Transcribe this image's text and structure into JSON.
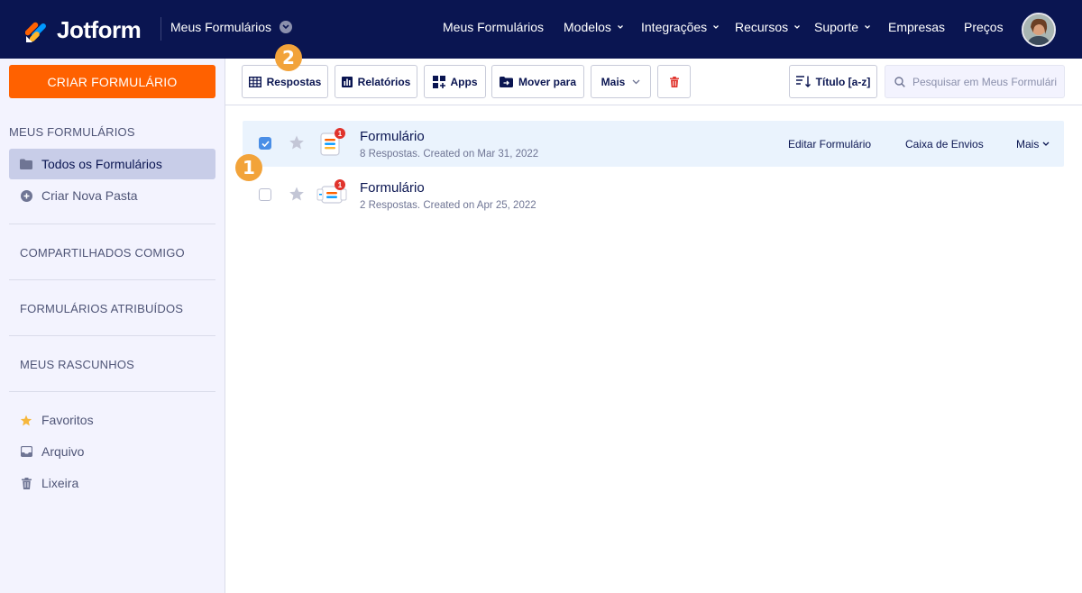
{
  "header": {
    "brand": "Jotform",
    "myforms_dropdown": "Meus Formulários",
    "nav": [
      {
        "label": "Meus Formulários",
        "caret": false
      },
      {
        "label": "Modelos",
        "caret": true
      },
      {
        "label": "Integrações",
        "caret": true
      },
      {
        "label": "Recursos",
        "caret": true
      },
      {
        "label": "Suporte",
        "caret": true
      },
      {
        "label": "Empresas",
        "caret": false
      },
      {
        "label": "Preços",
        "caret": false
      }
    ]
  },
  "sidebar": {
    "create_label": "CRIAR FORMULÁRIO",
    "heading": "MEUS FORMULÁRIOS",
    "items": [
      {
        "label": "Todos os Formulários",
        "icon": "folder-icon",
        "active": true
      },
      {
        "label": "Criar Nova Pasta",
        "icon": "plus-circle-icon",
        "active": false
      }
    ],
    "sections": [
      {
        "label": "COMPARTILHADOS COMIGO"
      },
      {
        "label": "FORMULÁRIOS ATRIBUÍDOS"
      },
      {
        "label": "MEUS RASCUNHOS"
      }
    ],
    "bottom_items": [
      {
        "label": "Favoritos",
        "icon": "star-icon"
      },
      {
        "label": "Arquivo",
        "icon": "archive-icon"
      },
      {
        "label": "Lixeira",
        "icon": "trash-icon"
      }
    ]
  },
  "toolbar": {
    "responses": "Respostas",
    "reports": "Relatórios",
    "apps": "Apps",
    "move_to": "Mover para",
    "more": "Mais",
    "sort": "Título [a-z]",
    "search_placeholder": "Pesquisar em Meus Formulários"
  },
  "forms": [
    {
      "title": "Formulário",
      "meta": "8 Respostas. Created on Mar 31, 2022",
      "selected": true,
      "badge": "1",
      "starred": false
    },
    {
      "title": "Formulário",
      "meta": "2 Respostas. Created on Apr 25, 2022",
      "selected": false,
      "badge": "1",
      "starred": false
    }
  ],
  "row_actions": {
    "edit": "Editar Formulário",
    "inbox": "Caixa de Envios",
    "more": "Mais"
  },
  "callouts": [
    "1",
    "2"
  ],
  "colors": {
    "navbar": "#0a1551",
    "accent_orange": "#ff6100",
    "sidebar_bg": "#f3f3fe",
    "selected_row": "#eaf3fd",
    "callout": "#f2a33a",
    "badge_red": "#e0332c",
    "checkbox_blue": "#4a8ee6"
  }
}
